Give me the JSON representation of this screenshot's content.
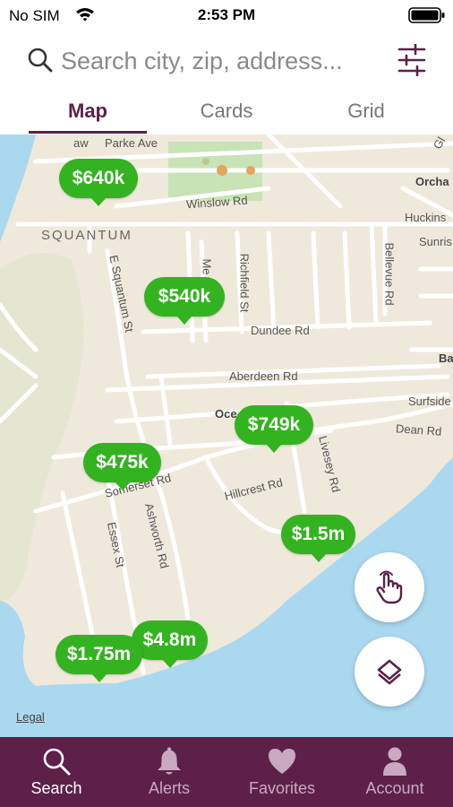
{
  "status_bar": {
    "carrier": "No SIM",
    "time": "2:53 PM",
    "wifi_icon": "wifi-icon",
    "battery_icon": "battery-icon"
  },
  "search": {
    "placeholder": "Search city, zip, address...",
    "value": "",
    "icon": "search-icon",
    "filter_icon": "sliders-icon"
  },
  "tabs": [
    {
      "label": "Map",
      "active": true
    },
    {
      "label": "Cards",
      "active": false
    },
    {
      "label": "Grid",
      "active": false
    }
  ],
  "map": {
    "place_label": "SQUANTUM",
    "street_labels": {
      "parke": "Parke Ave",
      "winslow": "Winslow Rd",
      "e_squantum": "E Squantum St",
      "richfield": "Richfield St",
      "me": "Me",
      "dundee": "Dundee Rd",
      "aberdeen": "Aberdeen Rd",
      "bellevue": "Bellevue Rd",
      "huckins": "Huckins",
      "sunris": "Sunris",
      "orcha": "Orcha",
      "ba": "Ba",
      "surfside": "Surfside",
      "dean": "Dean Rd",
      "livesey": "Livesey Rd",
      "hillcrest": "Hillcrest Rd",
      "ocea": "Oce",
      "somerset": "Somerset Rd",
      "ashworth": "Ashworth Rd",
      "essex": "Essex St",
      "gl": "Gl",
      "aw": "aw"
    },
    "legal": "Legal",
    "price_pins": [
      "$640k",
      "$540k",
      "$749k",
      "$475k",
      "$1.5m",
      "$4.8m",
      "$1.75m"
    ],
    "touch_button_icon": "hand-pointer-icon",
    "layers_button_icon": "layers-icon"
  },
  "bottom_nav": [
    {
      "label": "Search",
      "icon": "search-icon",
      "active": true
    },
    {
      "label": "Alerts",
      "icon": "bell-icon",
      "active": false
    },
    {
      "label": "Favorites",
      "icon": "heart-icon",
      "active": false
    },
    {
      "label": "Account",
      "icon": "person-icon",
      "active": false
    }
  ],
  "colors": {
    "brand": "#5d2149",
    "pin_green": "#33b31f",
    "water": "#aad8ef",
    "land": "#efe9dc",
    "park": "#c8e3b5"
  }
}
